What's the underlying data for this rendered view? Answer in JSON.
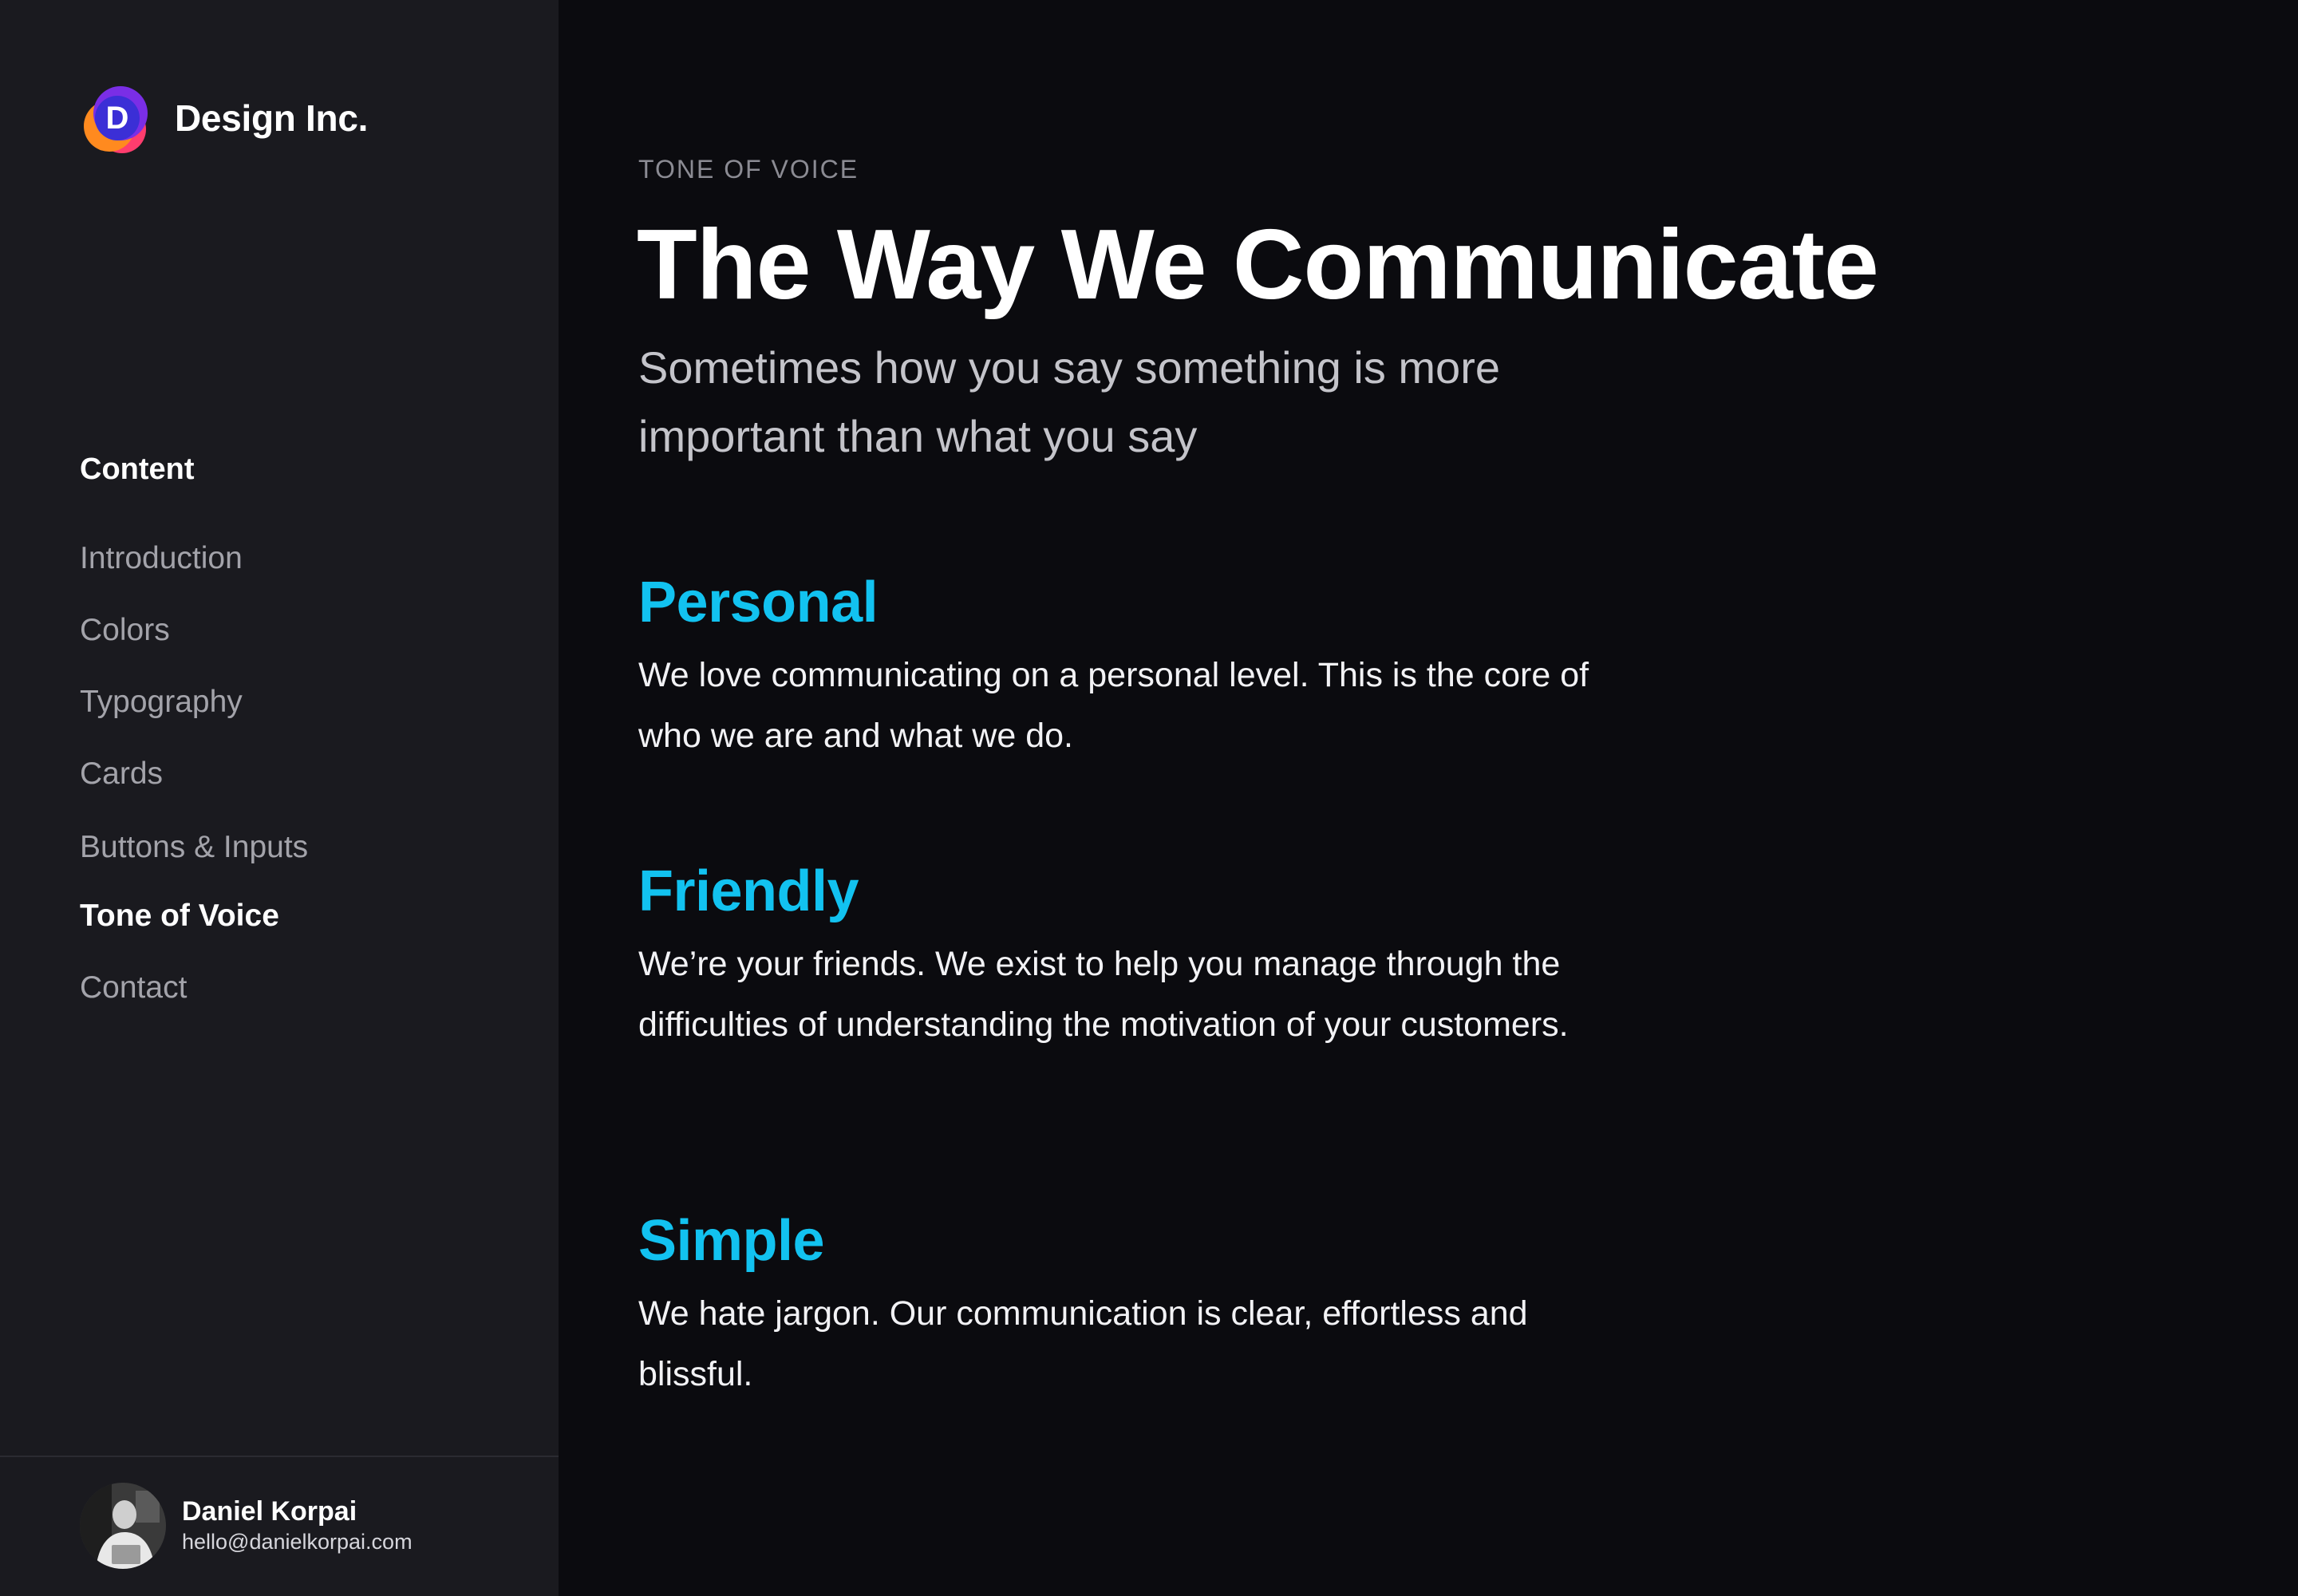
{
  "brand": {
    "name": "Design Inc.",
    "logo_letter": "D",
    "logo_colors": [
      "#7a2ee6",
      "#3b2fd6",
      "#ff8a1f",
      "#ff3d6e"
    ]
  },
  "nav": {
    "heading": "Content",
    "items": [
      {
        "label": "Introduction",
        "active": false
      },
      {
        "label": "Colors",
        "active": false
      },
      {
        "label": "Typography",
        "active": false
      },
      {
        "label": "Cards",
        "active": false
      },
      {
        "label": "Buttons & Inputs",
        "active": false
      },
      {
        "label": "Tone of Voice",
        "active": true
      },
      {
        "label": "Contact",
        "active": false
      }
    ]
  },
  "profile": {
    "name": "Daniel Korpai",
    "email": "hello@danielkorpai.com",
    "avatar_icon": "user-photo"
  },
  "main": {
    "eyebrow": "TONE OF VOICE",
    "title": "The Way We Communicate",
    "subtitle": "Sometimes how you say something is more important than what you say",
    "sections": [
      {
        "title": "Personal",
        "body": "We love communicating on a personal level. This is the core of who we are and what we do."
      },
      {
        "title": "Friendly",
        "body": "We’re your friends. We exist to help you manage through the difficulties of understanding the motivation of your customers."
      },
      {
        "title": "Simple",
        "body": "We hate jargon. Our communication is clear, effortless and blissful."
      }
    ]
  },
  "colors": {
    "accent": "#12c2f0",
    "sidebar_bg": "#1a1a1f",
    "main_bg": "#0b0b0f",
    "muted_text": "#a3a3aa"
  }
}
